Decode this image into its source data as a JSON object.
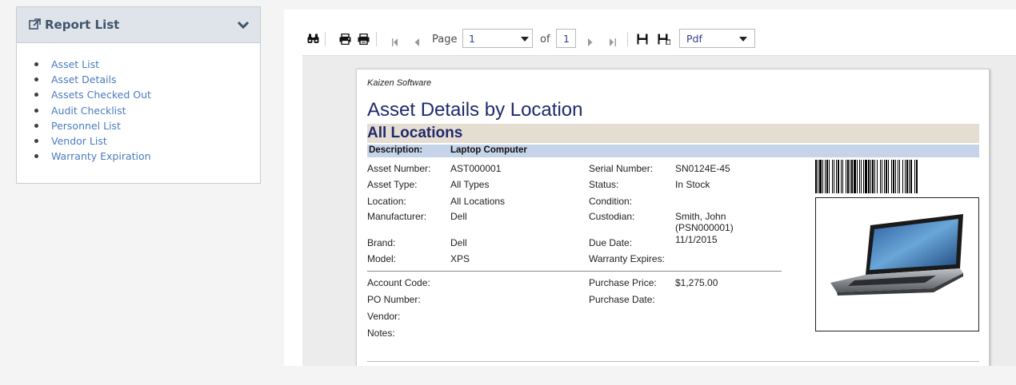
{
  "sidebar": {
    "title": "Report List",
    "icons": {
      "title": "external-link-icon",
      "toggle": "chevron-down-icon"
    },
    "items": [
      "Asset List",
      "Asset Details",
      "Assets Checked Out",
      "Audit Checklist",
      "Personnel List",
      "Vendor List",
      "Warranty Expiration"
    ]
  },
  "toolbar": {
    "page_label": "Page",
    "page_value": "1",
    "of_label": "of",
    "total_pages": "1",
    "export_format": "Pdf",
    "icons": [
      "binoculars-icon",
      "print-icon",
      "print-page-icon",
      "first-page-icon",
      "previous-page-icon",
      "next-page-icon",
      "last-page-icon",
      "save-icon",
      "save-as-icon"
    ]
  },
  "report": {
    "company": "Kaizen Software",
    "title": "Asset Details by Location",
    "location_group": "All Locations",
    "description_label": "Description:",
    "description_value": "Laptop Computer",
    "fields_left": [
      {
        "label": "Asset Number:",
        "value": "AST000001"
      },
      {
        "label": "Asset Type:",
        "value": "All Types"
      },
      {
        "label": "Location:",
        "value": "All Locations"
      },
      {
        "label": "Manufacturer:",
        "value": "Dell"
      },
      {
        "label": "Brand:",
        "value": "Dell"
      },
      {
        "label": "Model:",
        "value": "XPS"
      }
    ],
    "fields_right": [
      {
        "label": "Serial Number:",
        "value": "SN0124E-45"
      },
      {
        "label": "Status:",
        "value": "In Stock"
      },
      {
        "label": "Condition:",
        "value": ""
      },
      {
        "label": "Custodian:",
        "value": "Smith, John",
        "value2": "(PSN000001)"
      },
      {
        "label": "Due Date:",
        "value": "11/1/2015"
      },
      {
        "label": "Warranty Expires:",
        "value": ""
      }
    ],
    "fields_left2": [
      {
        "label": "Account Code:",
        "value": ""
      },
      {
        "label": "PO Number:",
        "value": ""
      },
      {
        "label": "Vendor:",
        "value": ""
      },
      {
        "label": "Notes:",
        "value": ""
      }
    ],
    "fields_right2": [
      {
        "label": "Purchase Price:",
        "value": "$1,275.00"
      },
      {
        "label": "Purchase Date:",
        "value": ""
      }
    ],
    "colors": {
      "title": "#1f2a6b",
      "location_band": "#e6ddd2",
      "description_band": "#c6d4ea"
    }
  }
}
